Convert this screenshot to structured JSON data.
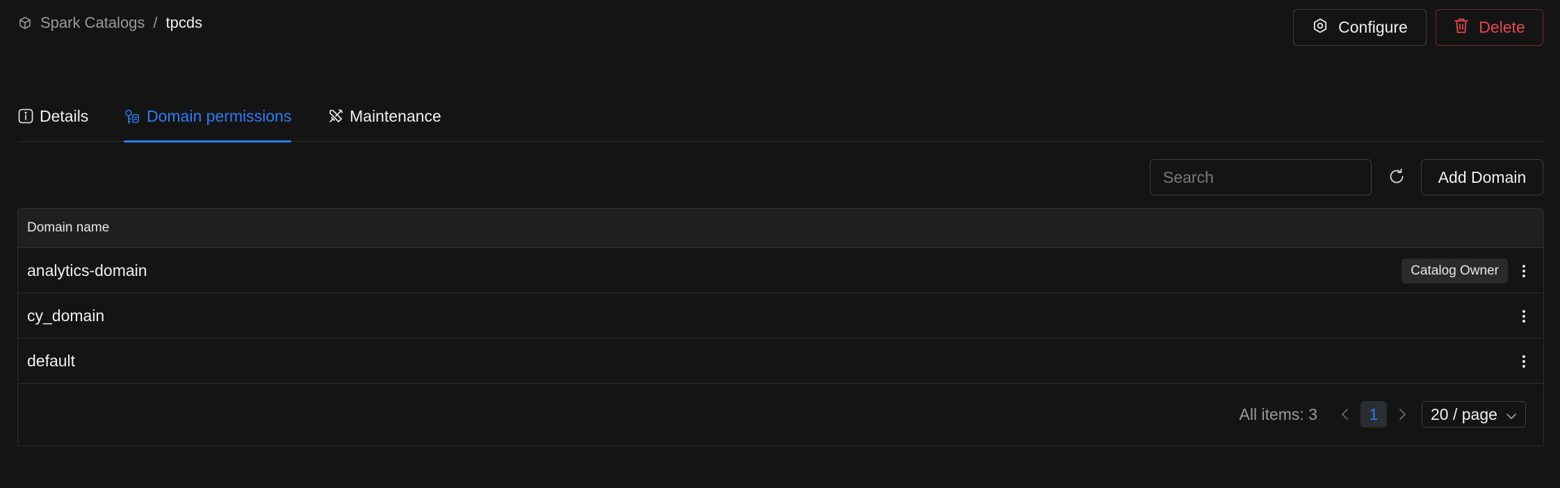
{
  "breadcrumb": {
    "parent": "Spark Catalogs",
    "separator": "/",
    "current": "tpcds",
    "icon": "cube-icon"
  },
  "header_actions": {
    "configure_label": "Configure",
    "delete_label": "Delete",
    "configure_icon": "settings-icon",
    "delete_icon": "trash-icon"
  },
  "tabs": [
    {
      "label": "Details",
      "icon": "info-icon",
      "active": false
    },
    {
      "label": "Domain permissions",
      "icon": "domain-permission-icon",
      "active": true
    },
    {
      "label": "Maintenance",
      "icon": "tools-icon",
      "active": false
    }
  ],
  "toolbar": {
    "search_placeholder": "Search",
    "search_value": "",
    "refresh_icon": "refresh-icon",
    "add_label": "Add Domain"
  },
  "table": {
    "columns": [
      "Domain name"
    ],
    "rows": [
      {
        "name": "analytics-domain",
        "badge": "Catalog Owner"
      },
      {
        "name": "cy_domain",
        "badge": ""
      },
      {
        "name": "default",
        "badge": ""
      }
    ]
  },
  "pagination": {
    "total_text": "All items: 3",
    "current_page": "1",
    "page_size": "20 / page"
  },
  "colors": {
    "accent": "#2f7bf5",
    "danger": "#e5484d",
    "background": "#141414"
  }
}
